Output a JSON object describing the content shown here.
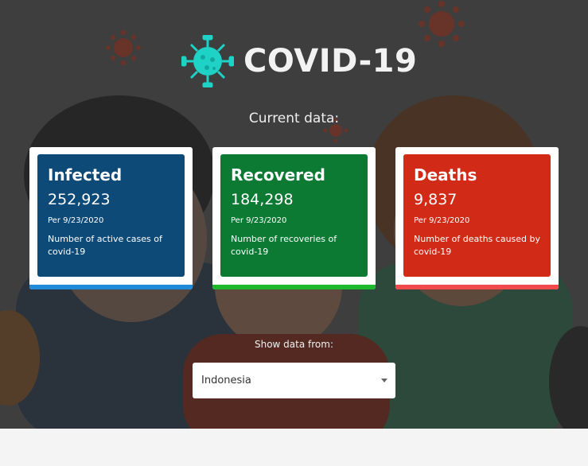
{
  "app": {
    "title": "COVID-19"
  },
  "subtitle": "Current data:",
  "colors": {
    "infected": "#0d4a78",
    "infected_bar": "#1f8ad8",
    "recovered": "#0d7a34",
    "recovered_bar": "#1db82e",
    "deaths": "#d12a16",
    "deaths_bar": "#f14a4a",
    "logo": "#1ed2c6"
  },
  "cards": [
    {
      "title": "Infected",
      "value": "252,923",
      "date": "Per 9/23/2020",
      "description": "Number of active cases of covid-19"
    },
    {
      "title": "Recovered",
      "value": "184,298",
      "date": "Per 9/23/2020",
      "description": "Number of recoveries of covid-19"
    },
    {
      "title": "Deaths",
      "value": "9,837",
      "date": "Per 9/23/2020",
      "description": "Number of deaths caused by covid-19"
    }
  ],
  "country_select": {
    "label": "Show data from:",
    "value": "Indonesia"
  },
  "icons": {
    "logo": "virus-icon",
    "dropdown": "chevron-down-icon",
    "decor": "virus-icon"
  }
}
